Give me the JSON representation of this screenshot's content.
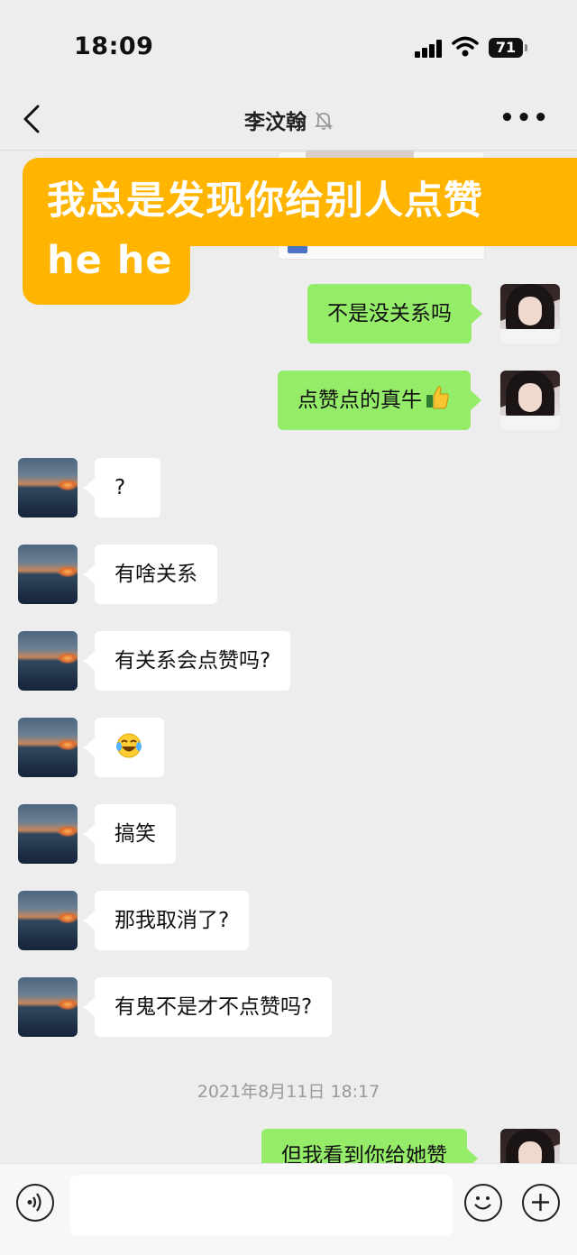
{
  "status_bar": {
    "time": "18:09",
    "battery": "71"
  },
  "nav": {
    "title": "李汶翰"
  },
  "banner": {
    "line1": "我总是发现你给别人点赞",
    "line2": "he he"
  },
  "messages": [
    {
      "side": "out",
      "text": "不是没关系吗"
    },
    {
      "side": "out",
      "text": "点赞点的真牛"
    },
    {
      "side": "in",
      "text": "?"
    },
    {
      "side": "in",
      "text": "有啥关系"
    },
    {
      "side": "in",
      "text": "有关系会点赞吗?"
    },
    {
      "side": "in",
      "text": ""
    },
    {
      "side": "in",
      "text": "搞笑"
    },
    {
      "side": "in",
      "text": "那我取消了?"
    },
    {
      "side": "in",
      "text": "有鬼不是才不点赞吗?"
    }
  ],
  "timestamp": "2021年8月11日 18:17",
  "last_message": {
    "side": "out",
    "text": "但我看到你给她赞"
  },
  "icons": {
    "back": "chevron-left-icon",
    "mute": "bell-off-icon",
    "more": "more-horizontal-icon",
    "voice": "voice-icon",
    "emoji": "smiley-icon",
    "plus": "plus-icon",
    "thumbs_up": "thumbs-up-emoji",
    "laugh": "tears-of-joy-emoji"
  },
  "colors": {
    "out_bubble": "#95ec69",
    "in_bubble": "#ffffff",
    "banner": "#ffb400",
    "background": "#ededed"
  }
}
